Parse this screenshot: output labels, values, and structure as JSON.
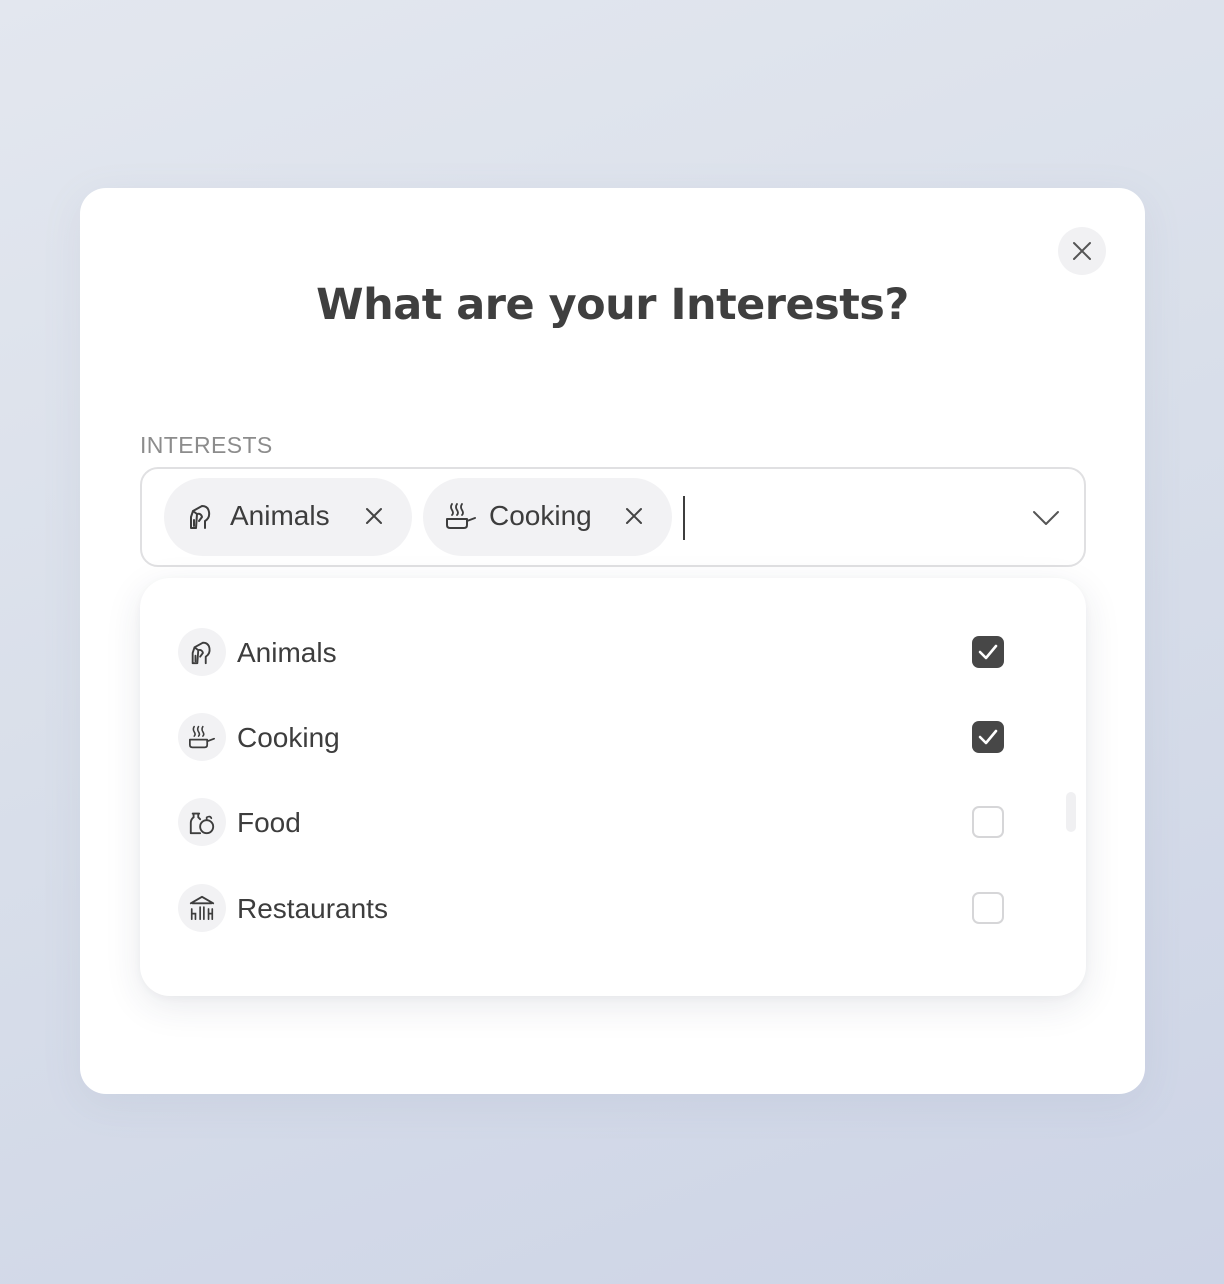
{
  "modal": {
    "title": "What are your Interests?",
    "close_icon": "close-icon"
  },
  "field": {
    "label": "INTERESTS",
    "chips": [
      {
        "label": "Animals",
        "icon": "animals-icon"
      },
      {
        "label": "Cooking",
        "icon": "cooking-icon"
      }
    ],
    "dropdown_icon": "chevron-down-icon"
  },
  "options": [
    {
      "label": "Animals",
      "icon": "animals-icon",
      "checked": true
    },
    {
      "label": "Cooking",
      "icon": "cooking-icon",
      "checked": true
    },
    {
      "label": "Food",
      "icon": "food-icon",
      "checked": false
    },
    {
      "label": "Restaurants",
      "icon": "restaurant-icon",
      "checked": false
    }
  ],
  "colors": {
    "checked_fill": "#474747",
    "unchecked_border": "#d6d6d8",
    "chip_bg": "#f2f2f4"
  }
}
